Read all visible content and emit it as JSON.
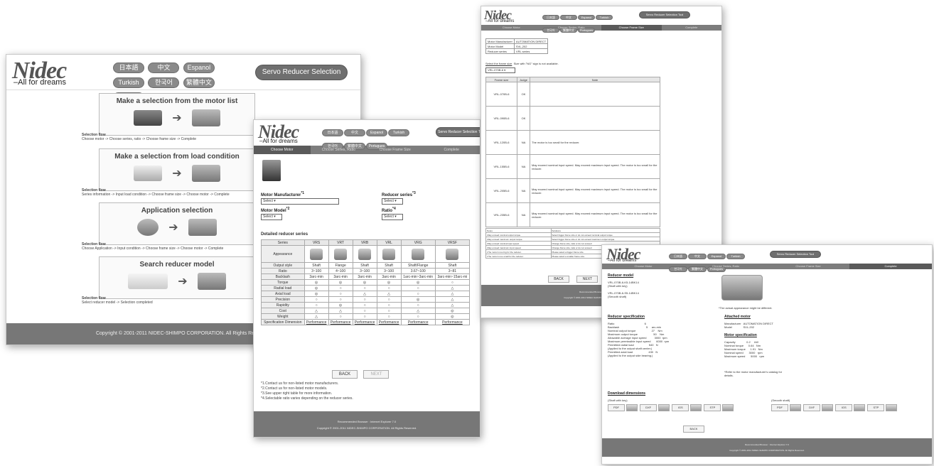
{
  "brand": {
    "logo": "Nidec",
    "tagline": "–All for dreams"
  },
  "languages": [
    "日本語",
    "中文",
    "Espanol",
    "Turkish",
    "한국어",
    "繁體中文",
    "Portugues"
  ],
  "tool_button": "Servo Reducer Selection Tool",
  "steps": [
    "Choose Motor",
    "Choose Series, Ratio",
    "Choose Frame Size",
    "Complete"
  ],
  "panelA": {
    "sections": [
      {
        "title": "Make a selection from the motor list",
        "flow_title": "Selection flow",
        "flow": "Choose motor -> Choose series, ratio -> Choose frame size -> Complete"
      },
      {
        "title": "Make a selection from load condition",
        "flow_title": "Selection flow",
        "flow": "Series information -> Input load condition -> Choose frame size -> Choose motor -> Complete"
      },
      {
        "title": "Application selection",
        "flow_title": "Selection flow",
        "flow": "Choose Application -> Input condition -> Choose frame size -> Choose motor -> Complete"
      },
      {
        "title": "Search reducer model",
        "flow_title": "Selection flow",
        "flow": "Select reducer model -> Selection completed"
      }
    ],
    "copyright": "Copyright © 2001-2011 NIDEC-SHIMPO CORPORATION. All Rights Reserved."
  },
  "panelB": {
    "motor_manufacturer_label": "Motor Manufacturer",
    "motor_manufacturer_note": "*1",
    "motor_manufacturer_value": "Select",
    "reducer_series_label": "Reducer series",
    "reducer_series_note": "*3",
    "reducer_series_value": "Select",
    "motor_model_label": "Motor Model",
    "motor_model_note": "*2",
    "motor_model_value": "Select",
    "ratio_label": "Ratio",
    "ratio_note": "*4",
    "ratio_value": "Select",
    "section_title": "Detailed reducer series",
    "columns": [
      "Series",
      "VRS",
      "VRT",
      "VRB",
      "VRL",
      "VRG",
      "VRSF"
    ],
    "rows": [
      [
        "Output style",
        "Shaft",
        "Flange",
        "Shaft",
        "Shaft",
        "Shaft/Flange",
        "Shaft"
      ],
      [
        "Ratio",
        "3~100",
        "4~100",
        "3~100",
        "3~100",
        "3.67~100",
        "3~81"
      ],
      [
        "Backlash",
        "3arc-min",
        "3arc-min",
        "3arc-min",
        "3arc-min",
        "1arc-min~3arc-min",
        "3arc-min~15arc-mi"
      ],
      [
        "Torque",
        "◎",
        "◎",
        "◎",
        "◎",
        "◎",
        "○"
      ],
      [
        "Radial load",
        "◎",
        "○",
        "○",
        "○",
        "○",
        "△"
      ],
      [
        "Axial load",
        "◎",
        "○",
        "△",
        "△",
        "○",
        "△"
      ],
      [
        "Precision",
        "○",
        "○",
        "○",
        "○",
        "◎",
        "△"
      ],
      [
        "Rapidity",
        "○",
        "◎",
        "○",
        "○",
        "○",
        "△"
      ],
      [
        "Cost",
        "△",
        "△",
        "○",
        "○",
        "△",
        "◎"
      ],
      [
        "Weight",
        "△",
        "○",
        "○",
        "○",
        "○",
        "◎"
      ]
    ],
    "appearance_label": "Appearance",
    "spec_label": "Specification Dimension",
    "spec_value": "Performance",
    "back": "BACK",
    "next": "NEXT",
    "notes": [
      "*1.Contact us for non-listed motor manufacturers.",
      "*2.Contact us for non-listed motor models.",
      "*3.See upper right table for more information.",
      "*4.Selectable ratio varies depending on the reducer series."
    ],
    "browser": "Recommended Browser : Internet Explorer 7.0",
    "copyright": "Copyright © 2001-2011 NIDEC-SHIMPO CORPORATION. All Rights Reserved."
  },
  "panelC": {
    "info": [
      [
        "Motor Manufacturer",
        "AUTOMATION DIRECT"
      ],
      [
        "Motor Model",
        "SVL-202"
      ],
      [
        "Reducer series",
        "VRL series"
      ]
    ],
    "select_frame": "Select the frame size",
    "select_note": "Size with \"NG\" sign is not available.",
    "select_value": "VRL-070B-6",
    "columns": [
      "Frame size",
      "Judge",
      "Note"
    ],
    "rows": [
      [
        "VRL-070B-6",
        "OK",
        ""
      ],
      [
        "VRL-090B-6",
        "OK",
        ""
      ],
      [
        "VRL-120B-6",
        "NA",
        "The motor is too small for the reducer."
      ],
      [
        "VRL-155B-6",
        "NA",
        "May exceed nominal input speed. May exceed maximum input speed. The motor is too small for the reducer."
      ],
      [
        "VRL-205B-6",
        "NA",
        "May exceed nominal input speed. May exceed maximum input speed. The motor is too small for the reducer."
      ],
      [
        "VRL-235B-6",
        "NA",
        "May exceed nominal input speed. May exceed maximum input speed. The motor is too small for the reducer."
      ]
    ],
    "notes_head": [
      "Notes",
      "Solutions"
    ],
    "notes": [
      [
        "•May exceed nominal output torque.",
        "Select bigger frame size or do not exceed nominal output torque."
      ],
      [
        "•May exceed maximum output torque.",
        "Select bigger frame size or do not exceed maximum output torque."
      ],
      [
        "•May exceed nominal input speed.",
        "Change frame size, ratio or do not exceed"
      ],
      [
        "•May exceed maximum input speed.",
        "Change frame size, ratio or do not exceed"
      ],
      [
        "•The motor is too big for the reducer.",
        "Please select a bigger frame size."
      ],
      [
        "•The motor is too small for the reducer.",
        "Please select a smaller frame size."
      ]
    ],
    "back": "BACK",
    "next": "NEXT",
    "browser": "Recommended Browser : Internet Explorer 7.0",
    "copyright": "Copyright © 2001-2011 NIDEC-SHIMPO CORPORATION. All Rights Reserved."
  },
  "panelD": {
    "model_title": "Reducer model",
    "model_text": "VRL-070B-6-K5-14BK14\n(Shaft with key)\n\nVRL-070B-6-S5-14BK14\n(Smooth shaft)",
    "appearance_note": "*The actual appearance might be different.",
    "spec_title": "Reducer specification",
    "spec_text": "Ratio                                      6\nBacklash                                  5     arc-min\nNominal output torque                    27    Nm\nMaximum output torque                    50    Nm\nAllowable average input speed          3000  rpm\nMaximum permissible input speed       6000  rpm\nPermitted radial load                   540   N\n(Applied to the output shaft center.)\nPermitted axial load                    430   N\n(Applied to the output side bearing.)",
    "motor_title": "Attached motor",
    "motor_text": "Manufacturer   AUTOMATION DIRECT\nModel              SVL-202",
    "mspec_title": "Motor specification",
    "mspec_text": "Capacity              0.2     kW\nNominal torque      0.64   Nm\nMaximum torque      1.91   Nm\nNominal speed       3000   rpm\nMaximum speed       5000   rpm",
    "mspec_note": "*Refer to the motor manufacturer's catalog for\ndetails.",
    "download_title": "Download dimensions",
    "dl_left_label": "(Shaft with key)",
    "dl_right_label": "(Smooth shaft)",
    "formats": [
      "PDF",
      "DXF",
      "IGS",
      "STP"
    ],
    "back": "BACK",
    "browser": "Recommended Browser : Internet Explorer 7.0",
    "copyright": "Copyright © 2001-2011 NIDEC-SHIMPO CORPORATION. All Rights Reserved."
  }
}
